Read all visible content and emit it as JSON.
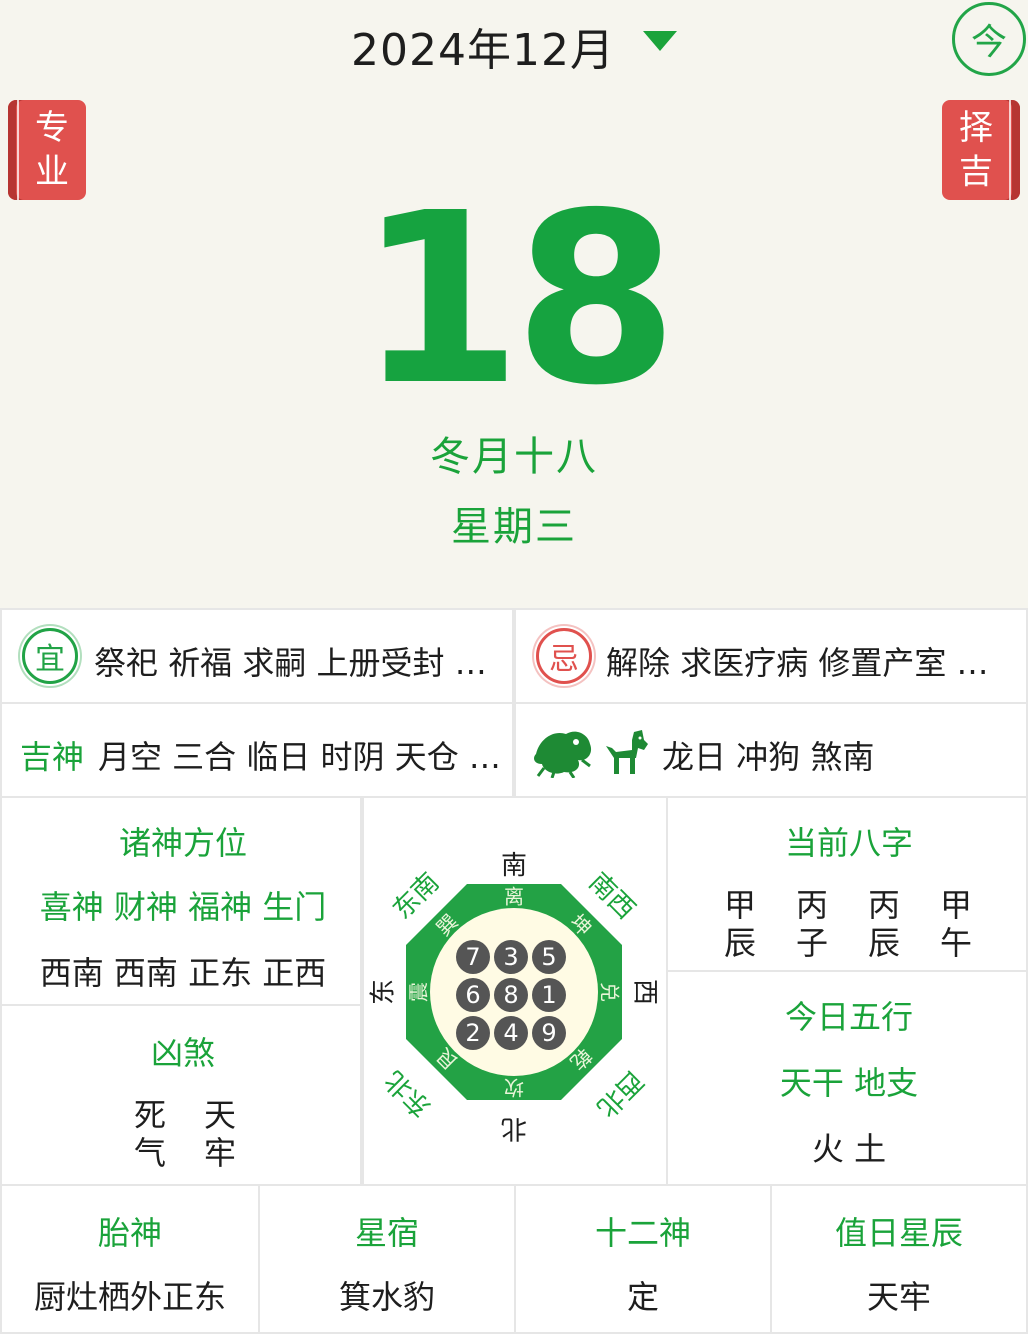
{
  "header": {
    "month": "2024年12月",
    "today_button": "今",
    "pro_tag": [
      "专",
      "业"
    ],
    "select_tag": [
      "择",
      "吉"
    ],
    "day": "18",
    "lunar_date": "冬月十八",
    "weekday": "星期三"
  },
  "yi": {
    "icon": "宜",
    "text": "祭祀 祈福 求嗣 上册受封 …"
  },
  "ji": {
    "icon": "忌",
    "text": "解除 求医疗病 修置产室 …"
  },
  "jishen": {
    "label": "吉神",
    "text": "月空 三合 临日 时阴 天仓 …"
  },
  "chong": {
    "icons": [
      "dragon-icon",
      "dog-icon"
    ],
    "text": "龙日 冲狗 煞南"
  },
  "zhushen": {
    "title": "诸神方位",
    "labels": "喜神 财神 福神 生门",
    "values": "西南 西南 正东 正西"
  },
  "xiongsha": {
    "title": "凶煞",
    "chars": [
      "死",
      "天",
      "气",
      "牢"
    ]
  },
  "bagua": {
    "directions": {
      "south": "南",
      "southwest": "南西",
      "west": "西",
      "northwest": "西北",
      "north": "北",
      "northeast": "东北",
      "east": "东",
      "southeast": "东南"
    },
    "trigrams": {
      "south": "离",
      "southwest": "坤",
      "west": "兑",
      "northwest": "乾",
      "north": "坎",
      "northeast": "艮",
      "east": "震",
      "southeast": "巽"
    },
    "numbers": [
      "7",
      "3",
      "5",
      "6",
      "8",
      "1",
      "2",
      "4",
      "9"
    ]
  },
  "bazi": {
    "title": "当前八字",
    "pillars": [
      [
        "甲",
        "辰"
      ],
      [
        "丙",
        "子"
      ],
      [
        "丙",
        "辰"
      ],
      [
        "甲",
        "午"
      ]
    ]
  },
  "wuxing": {
    "title": "今日五行",
    "labels": "天干 地支",
    "values": "火 土"
  },
  "bottom": [
    {
      "title": "胎神",
      "value": "厨灶栖外正东"
    },
    {
      "title": "星宿",
      "value": "箕水豹"
    },
    {
      "title": "十二神",
      "value": "定"
    },
    {
      "title": "值日星辰",
      "value": "天牢"
    }
  ],
  "colors": {
    "green": "#1aa33a",
    "red": "#e0514e",
    "background": "#f6f5ee",
    "octagon": "#23a245",
    "inner": "#fffbe4"
  }
}
